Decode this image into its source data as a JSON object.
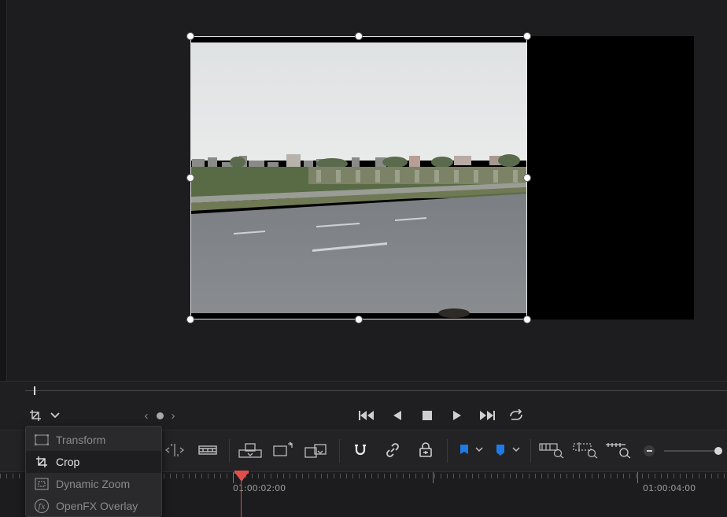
{
  "viewer": {
    "overlay_mode": "Crop"
  },
  "transport": {
    "icons": [
      "crop-mode-icon",
      "chevron-down-icon",
      "prev-edit-icon",
      "dot-icon",
      "next-edit-icon",
      "jump-to-start-icon",
      "play-reverse-icon",
      "stop-icon",
      "play-icon",
      "jump-to-end-icon",
      "loop-icon"
    ]
  },
  "toolbar": {
    "icons": [
      "slip-trim-icon",
      "film-strip-icon",
      "insert-clip-icon",
      "overwrite-clip-icon",
      "replace-clip-icon",
      "snapping-icon",
      "link-icon",
      "position-lock-icon",
      "flag-icon",
      "marker-icon",
      "full-extent-zoom-icon",
      "detail-zoom-icon",
      "custom-zoom-icon",
      "zoom-out-icon"
    ]
  },
  "dropdown": {
    "items": [
      {
        "label": "Transform",
        "icon": "transform-icon",
        "state": "dim"
      },
      {
        "label": "Crop",
        "icon": "crop-icon",
        "state": "active"
      },
      {
        "label": "Dynamic Zoom",
        "icon": "dynamic-zoom-icon",
        "state": "dim"
      },
      {
        "label": "OpenFX Overlay",
        "icon": "openfx-icon",
        "state": "dim"
      }
    ]
  },
  "timeline": {
    "timecodes": [
      "01:00:02:00",
      "01:00:04:00"
    ]
  },
  "colors": {
    "playhead": "#e0504a",
    "flag": "#1e7ae6",
    "marker": "#1e7ae6"
  }
}
